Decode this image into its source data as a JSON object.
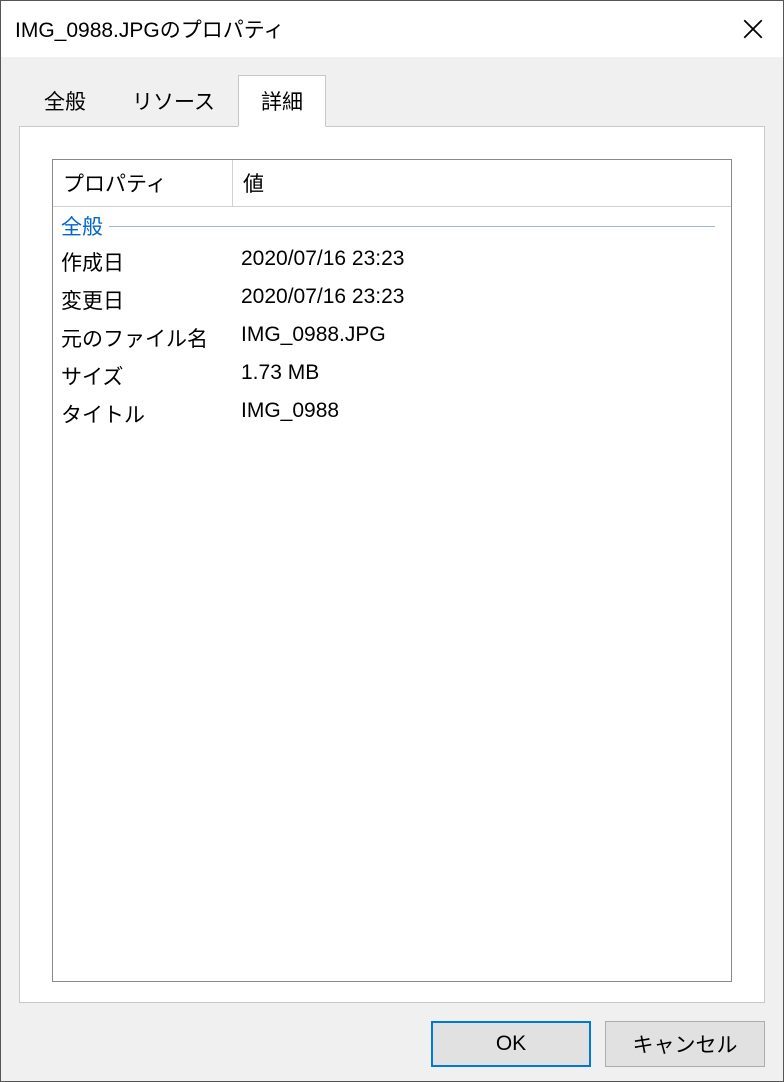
{
  "window": {
    "title": "IMG_0988.JPGのプロパティ"
  },
  "tabs": [
    {
      "label": "全般"
    },
    {
      "label": "リソース"
    },
    {
      "label": "詳細"
    }
  ],
  "active_tab": 2,
  "table": {
    "header": {
      "property": "プロパティ",
      "value": "値"
    },
    "group": "全般",
    "rows": [
      {
        "prop": "作成日",
        "val": "2020/07/16 23:23"
      },
      {
        "prop": "変更日",
        "val": "2020/07/16 23:23"
      },
      {
        "prop": "元のファイル名",
        "val": "IMG_0988.JPG"
      },
      {
        "prop": "サイズ",
        "val": "1.73 MB"
      },
      {
        "prop": "タイトル",
        "val": "IMG_0988"
      }
    ]
  },
  "buttons": {
    "ok": "OK",
    "cancel": "キャンセル"
  }
}
